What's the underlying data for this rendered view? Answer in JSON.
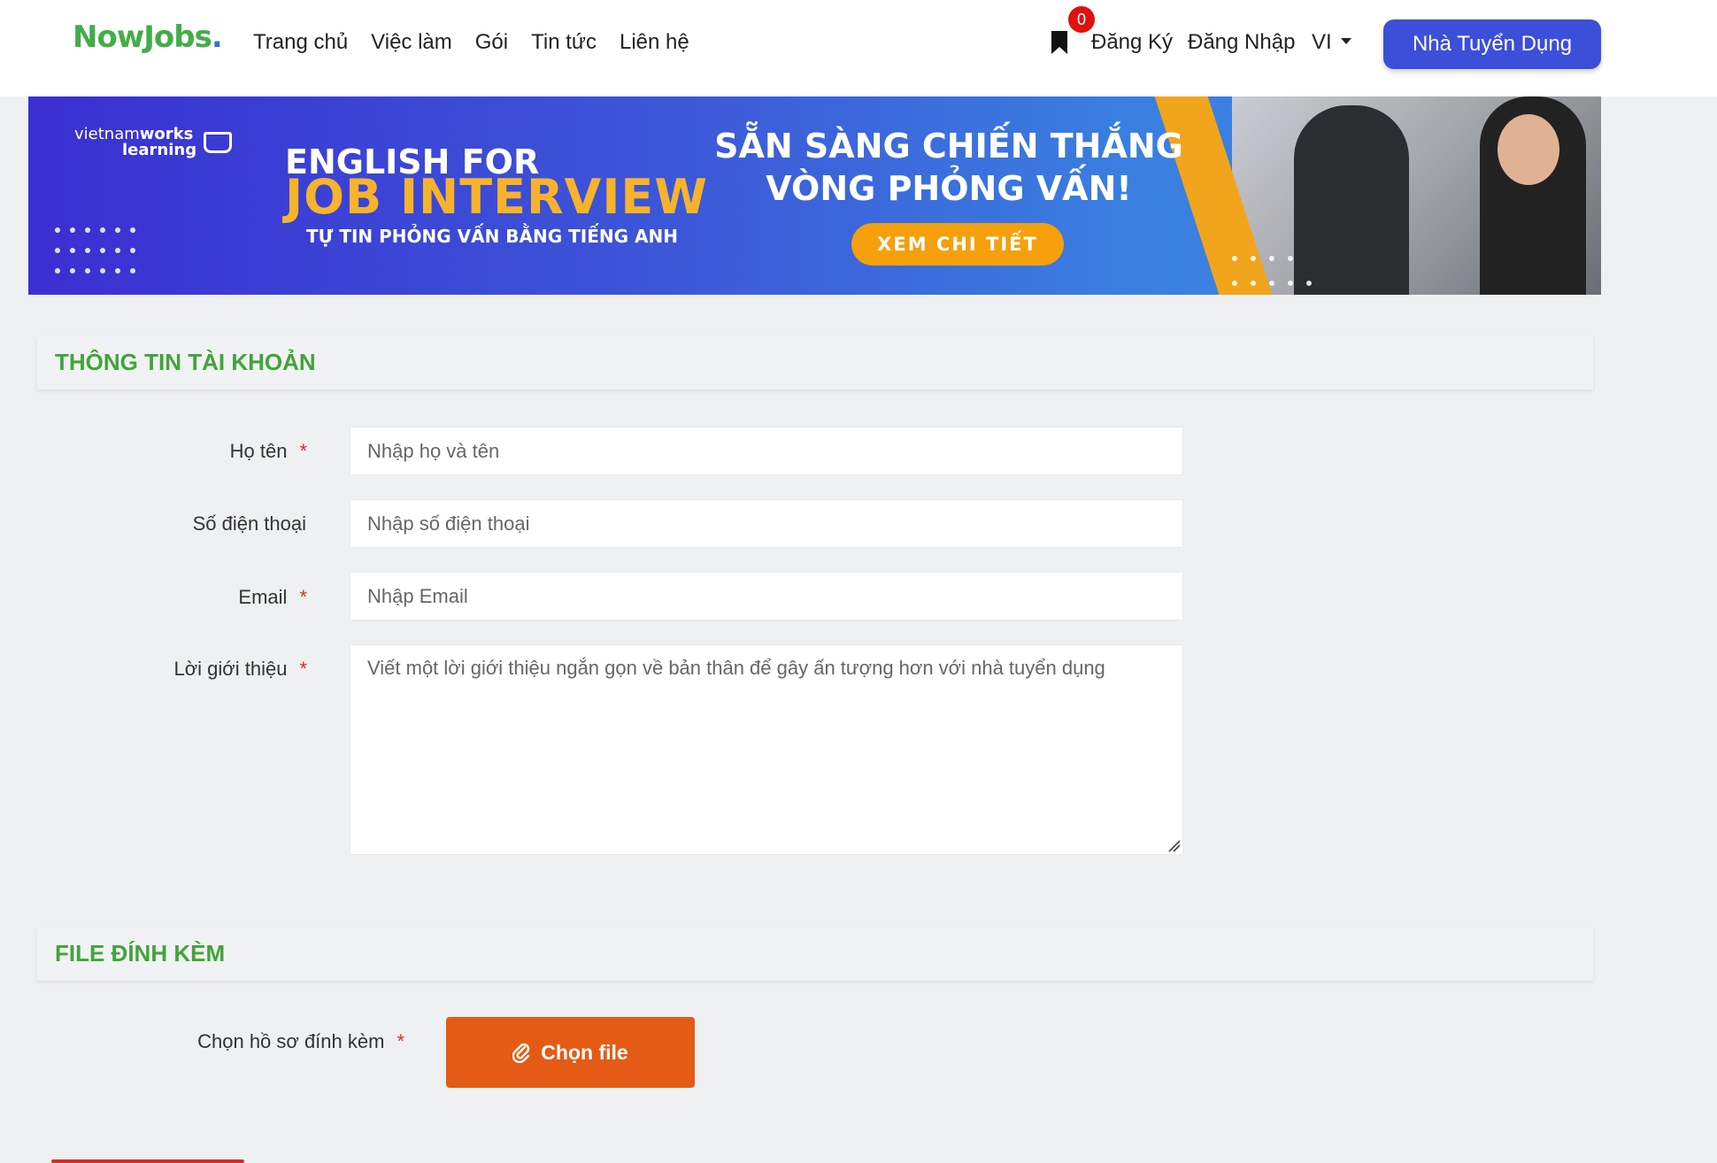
{
  "header": {
    "logo_main": "NowJobs",
    "logo_dot": ".",
    "nav": [
      "Trang chủ",
      "Việc làm",
      "Gói",
      "Tin tức",
      "Liên hệ"
    ],
    "saved_count": "0",
    "register": "Đăng Ký",
    "login": "Đăng Nhập",
    "language": "VI",
    "employer_button": "Nhà Tuyển Dụng"
  },
  "banner": {
    "brand_line1_light": "vietnam",
    "brand_line1_bold": "works",
    "brand_line2": "learning",
    "title_line1": "ENGLISH FOR",
    "title_line2": "JOB INTERVIEW",
    "title_line3": "TỰ TIN PHỎNG VẤN BẰNG TIẾNG ANH",
    "headline_line1": "SẴN SÀNG CHIẾN THẮNG",
    "headline_line2": "VÒNG PHỎNG VẤN!",
    "cta": "XEM CHI TIẾT"
  },
  "account_section": {
    "title": "THÔNG TIN TÀI KHOẢN",
    "fields": {
      "name": {
        "label": "Họ tên",
        "required_mark": "*",
        "placeholder": "Nhập họ và tên"
      },
      "phone": {
        "label": "Số điện thoại",
        "placeholder": "Nhập số điện thoại"
      },
      "email": {
        "label": "Email",
        "required_mark": "*",
        "placeholder": "Nhập Email"
      },
      "intro": {
        "label": "Lời giới thiệu",
        "required_mark": "*",
        "placeholder": "Viết một lời giới thiệu ngắn gọn về bản thân để gây ấn tượng hơn với nhà tuyển dụng"
      }
    }
  },
  "attachment_section": {
    "title": "FILE ĐÍNH KÈM",
    "label": "Chọn hồ sơ đính kèm",
    "required_mark": "*",
    "button": "Chọn file"
  },
  "colors": {
    "brand_green": "#43ad49",
    "primary_blue": "#3b4fd8",
    "section_title_green": "#43a33b",
    "file_button_orange": "#e35b14",
    "required_red": "#e02a2a"
  }
}
